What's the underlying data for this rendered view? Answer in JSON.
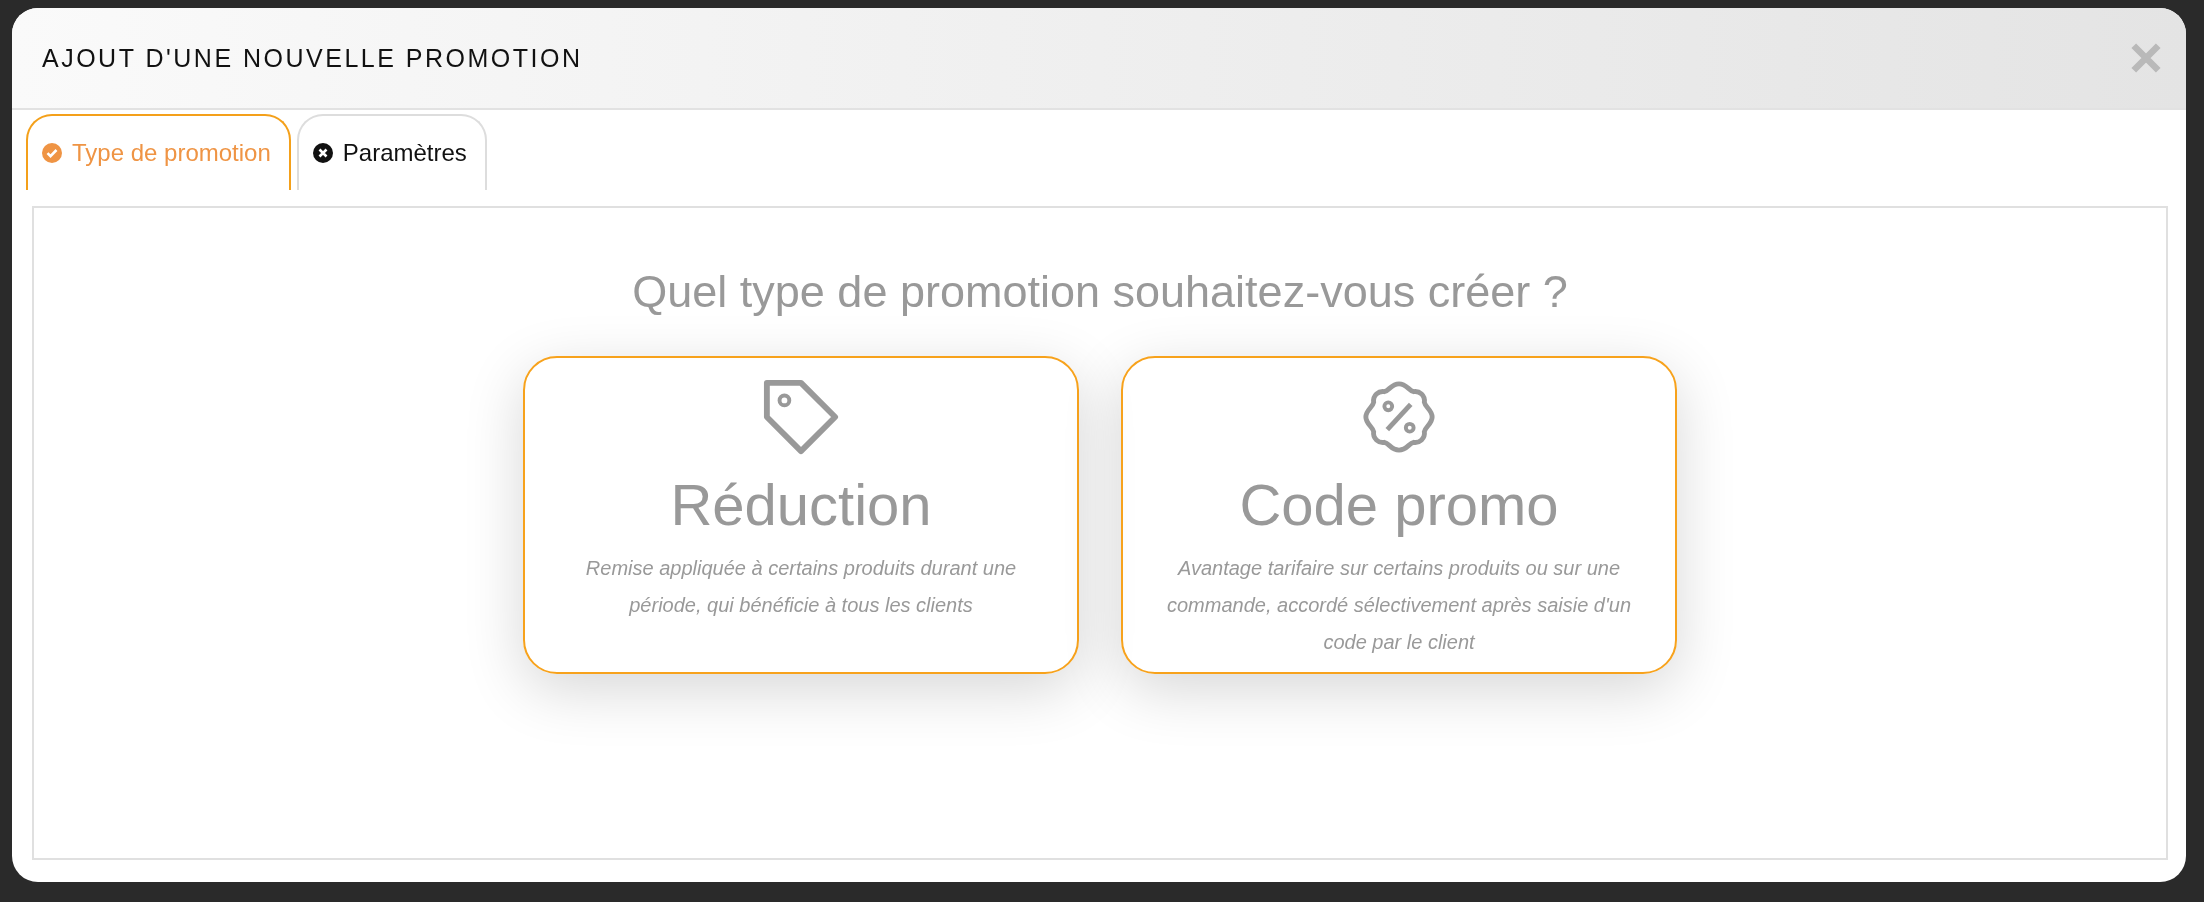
{
  "window": {
    "title": "AJOUT D'UNE NOUVELLE PROMOTION"
  },
  "tabs": [
    {
      "label": "Type de promotion",
      "selected": true,
      "kind": "done"
    },
    {
      "label": "Paramètres",
      "selected": false,
      "kind": "error"
    }
  ],
  "question": "Quel type de promotion souhaitez-vous créer ?",
  "options": [
    {
      "kind": "tag",
      "title": "Réduction",
      "description": "Remise appliquée à certains produits durant une période, qui bénéficie à tous les clients"
    },
    {
      "kind": "percent-badge",
      "title": "Code promo",
      "description": "Avantage tarifaire sur certains produits ou sur une commande, accordé sélectivement après saisie d'un code par le client"
    }
  ]
}
